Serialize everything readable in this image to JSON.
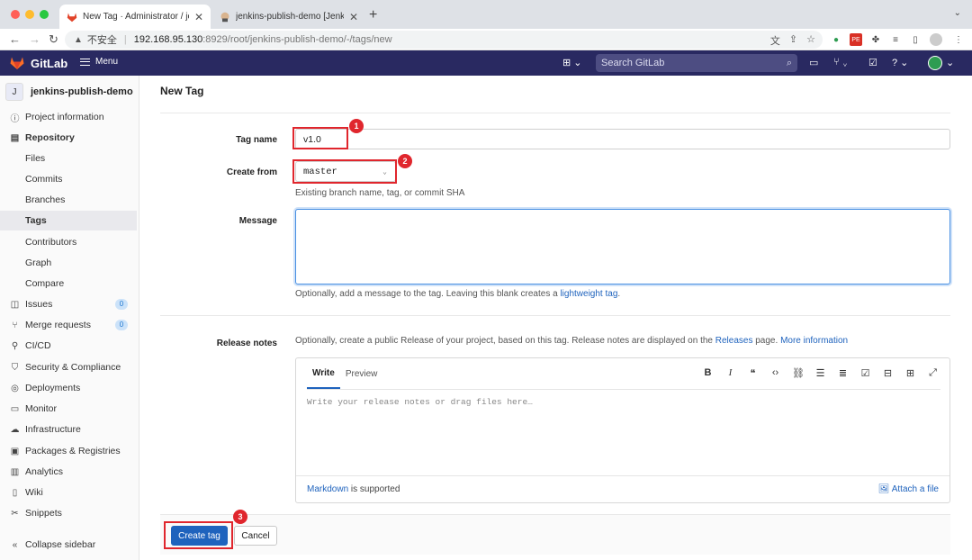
{
  "browser": {
    "tabs": [
      {
        "title": "New Tag · Administrator / jenkins",
        "close": "✕"
      },
      {
        "title": "jenkins-publish-demo [Jenkins]",
        "close": "✕"
      }
    ],
    "new_tab": "+",
    "address": {
      "security_label": "不安全",
      "host": "192.168.95.130",
      "path": ":8929/root/jenkins-publish-demo/-/tags/new"
    }
  },
  "header": {
    "brand": "GitLab",
    "menu_label": "Menu",
    "search_placeholder": "Search GitLab"
  },
  "sidebar": {
    "project_initial": "J",
    "project_name": "jenkins-publish-demo",
    "items": [
      {
        "label": "Project information",
        "icon": "info-icon"
      },
      {
        "label": "Repository",
        "icon": "repository-icon"
      },
      {
        "label": "Files"
      },
      {
        "label": "Commits"
      },
      {
        "label": "Branches"
      },
      {
        "label": "Tags"
      },
      {
        "label": "Contributors"
      },
      {
        "label": "Graph"
      },
      {
        "label": "Compare"
      },
      {
        "label": "Issues",
        "icon": "issues-icon",
        "badge": "0"
      },
      {
        "label": "Merge requests",
        "icon": "merge-request-icon",
        "badge": "0"
      },
      {
        "label": "CI/CD",
        "icon": "rocket-icon"
      },
      {
        "label": "Security & Compliance",
        "icon": "shield-icon"
      },
      {
        "label": "Deployments",
        "icon": "deployments-icon"
      },
      {
        "label": "Monitor",
        "icon": "monitor-icon"
      },
      {
        "label": "Infrastructure",
        "icon": "cloud-icon"
      },
      {
        "label": "Packages & Registries",
        "icon": "package-icon"
      },
      {
        "label": "Analytics",
        "icon": "chart-icon"
      },
      {
        "label": "Wiki",
        "icon": "book-icon"
      },
      {
        "label": "Snippets",
        "icon": "scissors-icon"
      }
    ],
    "collapse_label": "Collapse sidebar"
  },
  "form": {
    "title": "New Tag",
    "tag_name_label": "Tag name",
    "tag_name_value": "v1.0",
    "create_from_label": "Create from",
    "create_from_value": "master",
    "create_from_help": "Existing branch name, tag, or commit SHA",
    "message_label": "Message",
    "message_help_prefix": "Optionally, add a message to the tag. Leaving this blank creates a",
    "message_help_link": "lightweight tag",
    "message_help_suffix": ".",
    "release_notes_label": "Release notes",
    "release_help_prefix": "Optionally, create a public Release of your project, based on this tag. Release notes are displayed on the",
    "release_help_link": "Releases",
    "release_help_mid": "page.",
    "release_help_more": "More information",
    "editor": {
      "write_tab": "Write",
      "preview_tab": "Preview",
      "placeholder": "Write your release notes or drag files here…",
      "markdown_link": "Markdown",
      "markdown_suffix": "is supported",
      "attach_label": "Attach a file"
    },
    "create_button": "Create tag",
    "cancel_button": "Cancel"
  },
  "annotations": [
    "1",
    "2",
    "3"
  ],
  "colors": {
    "header_bg": "#292961",
    "primary": "#1f63bd",
    "annotation_red": "#e0262d"
  }
}
